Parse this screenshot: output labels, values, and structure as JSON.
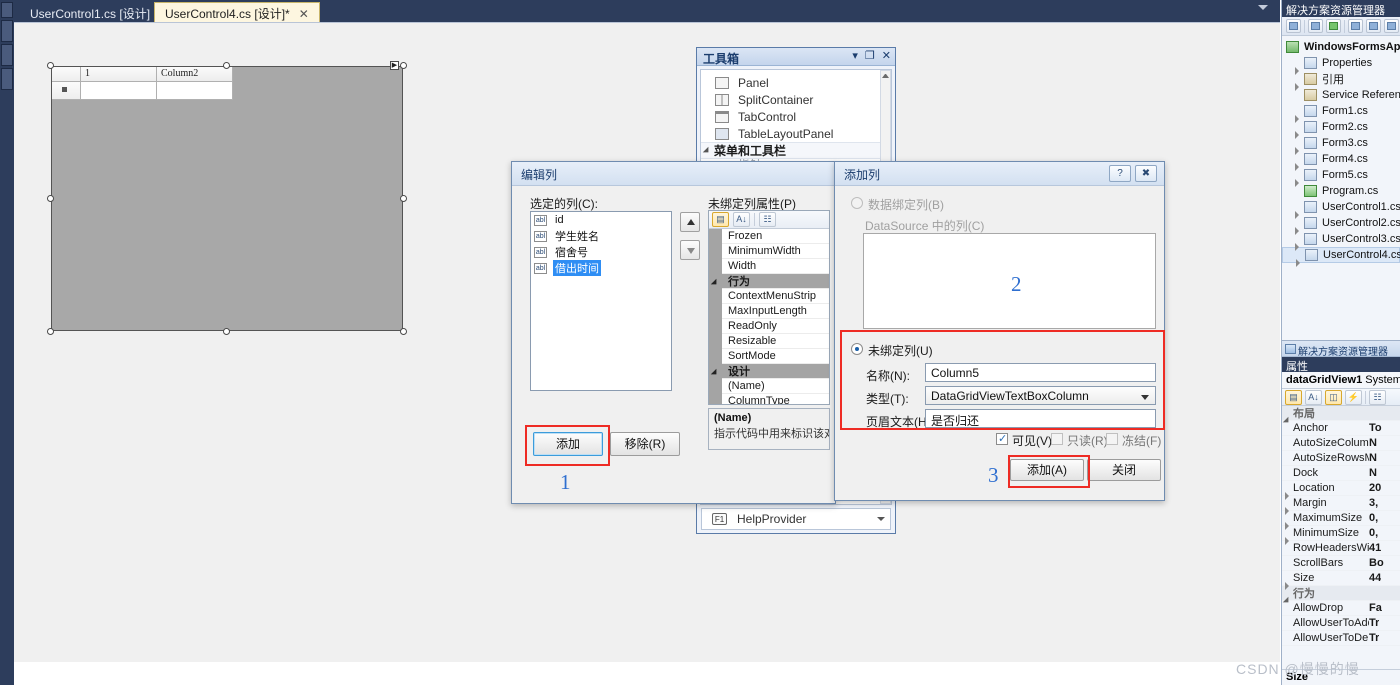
{
  "tabs": [
    {
      "label": "UserControl1.cs [设计]",
      "active": false
    },
    {
      "label": "UserControl4.cs [设计]*",
      "active": true,
      "close": "✕"
    }
  ],
  "designer": {
    "grid": {
      "columns": [
        "1",
        "Column2"
      ],
      "new_row_marker": "*"
    }
  },
  "toolbox": {
    "title": "工具箱",
    "buttons": {
      "dropdown": "▾",
      "maximize": "❐",
      "close": "✕"
    },
    "items": [
      {
        "label": "Panel",
        "icon": "panel-icon"
      },
      {
        "label": "SplitContainer",
        "icon": "splitcontainer-icon"
      },
      {
        "label": "TabControl",
        "icon": "tabcontrol-icon"
      },
      {
        "label": "TableLayoutPanel",
        "icon": "tablelayoutpanel-icon"
      }
    ],
    "group": "菜单和工具栏",
    "group_partial_item": "指针",
    "bottom_item": {
      "key": "F1",
      "label": "HelpProvider"
    }
  },
  "edit_columns_dialog": {
    "title": "编辑列",
    "selected_label": "选定的列(C):",
    "columns": [
      {
        "name": "id",
        "selected": false
      },
      {
        "name": "学生姓名",
        "selected": false
      },
      {
        "name": "宿舍号",
        "selected": false
      },
      {
        "name": "借出时间",
        "selected": true
      }
    ],
    "move_up": "⬆",
    "move_down": "⬇",
    "add_button": "添加",
    "remove_button": "移除(R)",
    "props_label": "未绑定列属性(P)",
    "property_rows": [
      {
        "name": "Frozen",
        "category": false
      },
      {
        "name": "MinimumWidth",
        "category": false
      },
      {
        "name": "Width",
        "category": false
      },
      {
        "name": "行为",
        "category": true
      },
      {
        "name": "ContextMenuStrip",
        "category": false
      },
      {
        "name": "MaxInputLength",
        "category": false
      },
      {
        "name": "ReadOnly",
        "category": false
      },
      {
        "name": "Resizable",
        "category": false
      },
      {
        "name": "SortMode",
        "category": false
      },
      {
        "name": "设计",
        "category": true
      },
      {
        "name": "(Name)",
        "category": false
      },
      {
        "name": "ColumnType",
        "category": false
      }
    ],
    "desc_title": "(Name)",
    "desc_text": "指示代码中用来标识该对象"
  },
  "add_column_dialog": {
    "title": "添加列",
    "help_button": "?",
    "close_button": "✖",
    "databound_radio": "数据绑定列(B)",
    "datasource_label": "DataSource 中的列(C)",
    "unbound_radio": "未绑定列(U)",
    "name_label": "名称(N):",
    "name_value": "Column5",
    "type_label": "类型(T):",
    "type_value": "DataGridViewTextBoxColumn",
    "header_label": "页眉文本(H):",
    "header_value": "是否归还",
    "checkboxes": [
      {
        "label": "可见(V)",
        "checked": true,
        "enabled": true
      },
      {
        "label": "只读(R)",
        "checked": false,
        "enabled": false
      },
      {
        "label": "冻结(F)",
        "checked": false,
        "enabled": false
      }
    ],
    "add_button": "添加(A)",
    "close_btn": "关闭"
  },
  "annotations": [
    {
      "number": "1"
    },
    {
      "number": "2"
    },
    {
      "number": "3"
    }
  ],
  "solution_explorer": {
    "title": "解决方案资源管理器",
    "root": "WindowsFormsApp",
    "nodes": [
      {
        "label": "Properties",
        "expandable": true,
        "icon": "properties-icon"
      },
      {
        "label": "引用",
        "expandable": true,
        "icon": "references-icon"
      },
      {
        "label": "Service References",
        "expandable": false,
        "icon": "service-ref-icon"
      },
      {
        "label": "Form1.cs",
        "expandable": true,
        "icon": "form-icon"
      },
      {
        "label": "Form2.cs",
        "expandable": true,
        "icon": "form-icon"
      },
      {
        "label": "Form3.cs",
        "expandable": true,
        "icon": "form-icon"
      },
      {
        "label": "Form4.cs",
        "expandable": true,
        "icon": "form-icon"
      },
      {
        "label": "Form5.cs",
        "expandable": true,
        "icon": "form-icon"
      },
      {
        "label": "Program.cs",
        "expandable": false,
        "icon": "cs-file-icon"
      },
      {
        "label": "UserControl1.cs",
        "expandable": true,
        "icon": "usercontrol-icon"
      },
      {
        "label": "UserControl2.cs",
        "expandable": true,
        "icon": "usercontrol-icon"
      },
      {
        "label": "UserControl3.cs",
        "expandable": true,
        "icon": "usercontrol-icon"
      },
      {
        "label": "UserControl4.cs",
        "expandable": true,
        "icon": "usercontrol-icon",
        "selected": true
      }
    ]
  },
  "properties_panel": {
    "tab_label": "解决方案资源管理器",
    "header": "属性",
    "object_name": "dataGridView1",
    "object_type": "System.W",
    "rows": [
      {
        "name": "布局",
        "value": "",
        "category": true,
        "expandable": false
      },
      {
        "name": "Anchor",
        "value": "To",
        "category": false,
        "expandable": false
      },
      {
        "name": "AutoSizeColumnsM",
        "value": "N",
        "category": false,
        "expandable": false
      },
      {
        "name": "AutoSizeRowsMoc",
        "value": "N",
        "category": false,
        "expandable": false
      },
      {
        "name": "Dock",
        "value": "N",
        "category": false,
        "expandable": false
      },
      {
        "name": "Location",
        "value": "20",
        "category": false,
        "expandable": true
      },
      {
        "name": "Margin",
        "value": "3,",
        "category": false,
        "expandable": true
      },
      {
        "name": "MaximumSize",
        "value": "0,",
        "category": false,
        "expandable": true
      },
      {
        "name": "MinimumSize",
        "value": "0,",
        "category": false,
        "expandable": true
      },
      {
        "name": "RowHeadersWidth",
        "value": "41",
        "category": false,
        "expandable": false
      },
      {
        "name": "ScrollBars",
        "value": "Bo",
        "category": false,
        "expandable": false
      },
      {
        "name": "Size",
        "value": "44",
        "category": false,
        "expandable": true
      },
      {
        "name": "行为",
        "value": "",
        "category": true,
        "expandable": false
      },
      {
        "name": "AllowDrop",
        "value": "Fa",
        "category": false,
        "expandable": false
      },
      {
        "name": "AllowUserToAddR",
        "value": "Tr",
        "category": false,
        "expandable": false
      },
      {
        "name": "AllowUserToDelete",
        "value": "Tr",
        "category": false,
        "expandable": false
      }
    ],
    "footer": "Size"
  },
  "watermark": "CSDN @慢慢的慢"
}
